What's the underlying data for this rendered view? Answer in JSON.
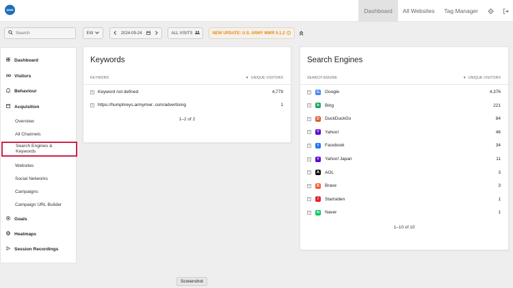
{
  "app": {
    "logo_text": "MWR"
  },
  "topnav": {
    "items": [
      {
        "label": "Dashboard"
      },
      {
        "label": "All Websites"
      },
      {
        "label": "Tag Manager"
      }
    ],
    "icons": [
      "gear-icon",
      "logout-icon"
    ]
  },
  "toolbar": {
    "search_placeholder": "Search",
    "period_label": "EW",
    "date": "2024-09-24",
    "segment_label": "ALL VISITS",
    "update_label": "NEW UPDATE: U.S. ARMY MWR 5.1.2"
  },
  "sidebar": {
    "items": [
      {
        "label": "Dashboard",
        "icon": "dashboard-icon"
      },
      {
        "label": "Visitors",
        "icon": "visitors-icon"
      },
      {
        "label": "Behaviour",
        "icon": "behaviour-icon"
      },
      {
        "label": "Acquisition",
        "icon": "acquisition-icon"
      },
      {
        "label": "Overview"
      },
      {
        "label": "All Channels"
      },
      {
        "label": "Search Engines & Keywords"
      },
      {
        "label": "Websites"
      },
      {
        "label": "Social Networks"
      },
      {
        "label": "Campaigns"
      },
      {
        "label": "Campaign URL Builder"
      },
      {
        "label": "Goals",
        "icon": "goals-icon"
      },
      {
        "label": "Heatmaps",
        "icon": "heatmaps-icon"
      },
      {
        "label": "Session Recordings",
        "icon": "session-recordings-icon"
      }
    ]
  },
  "keywords": {
    "title": "Keywords",
    "col1": "KEYWORD",
    "col2": "UNIQUE VISITORS",
    "rows": [
      {
        "label": "Keyword not defined",
        "value": "4,779"
      },
      {
        "label": "https://humphreys.armymwr..com/advertising",
        "value": "1"
      }
    ],
    "pager": "1–2 of 2"
  },
  "search_engines": {
    "title": "Search Engines",
    "col1": "SEARCH ENGINE",
    "col2": "UNIQUE VISITORS",
    "rows": [
      {
        "label": "Google",
        "value": "4,376",
        "icon": "google-icon",
        "color": "#4285f4",
        "glyph": "G"
      },
      {
        "label": "Bing",
        "value": "221",
        "icon": "bing-icon",
        "color": "#1fa463",
        "glyph": "b"
      },
      {
        "label": "DuckDuckGo",
        "value": "84",
        "icon": "duckduckgo-icon",
        "color": "#de5833",
        "glyph": "D"
      },
      {
        "label": "Yahoo!",
        "value": "46",
        "icon": "yahoo-icon",
        "color": "#6001d2",
        "glyph": "Y"
      },
      {
        "label": "Facebook",
        "value": "34",
        "icon": "facebook-icon",
        "color": "#1877f2",
        "glyph": "f"
      },
      {
        "label": "Yahoo! Japan",
        "value": "11",
        "icon": "yahoo-japan-icon",
        "color": "#6001d2",
        "glyph": "Y"
      },
      {
        "label": "AOL",
        "value": "3",
        "icon": "aol-icon",
        "color": "#111111",
        "glyph": "A"
      },
      {
        "label": "Brave",
        "value": "3",
        "icon": "brave-icon",
        "color": "#fb542b",
        "glyph": "B"
      },
      {
        "label": "Startsiden",
        "value": "1",
        "icon": "startsiden-icon",
        "color": "#e4202e",
        "glyph": "/"
      },
      {
        "label": "Naver",
        "value": "1",
        "icon": "naver-icon",
        "color": "#03c75a",
        "glyph": "N"
      }
    ],
    "pager": "1–10 of 10"
  },
  "screenshot_label": "Screenshot"
}
